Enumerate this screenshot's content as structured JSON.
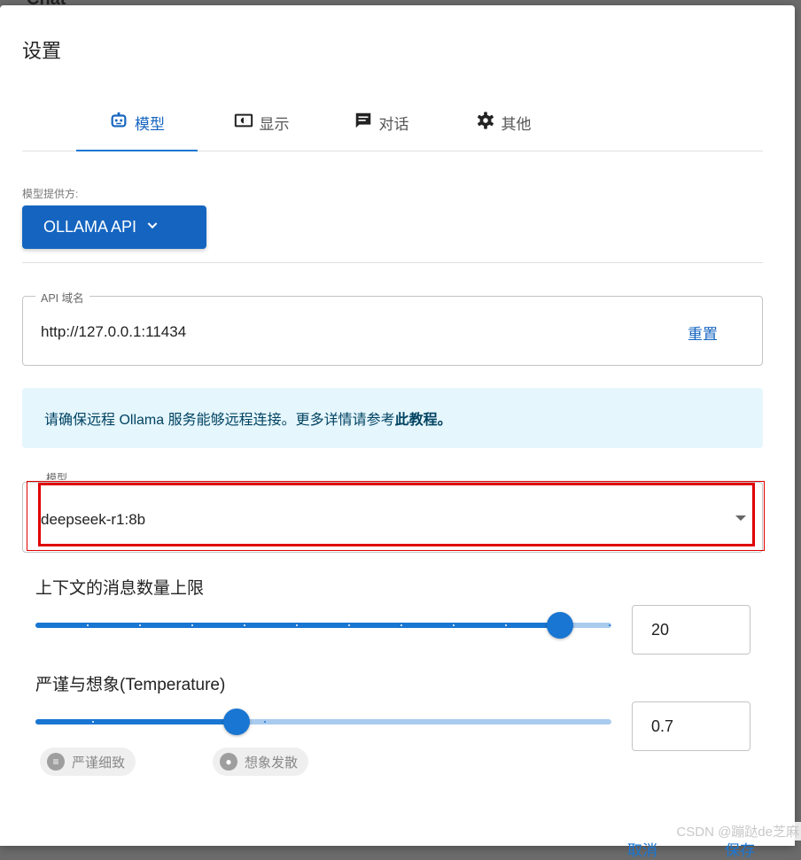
{
  "background": {
    "title": "Chat"
  },
  "dialog": {
    "title": "设置",
    "tabs": [
      {
        "label": "模型",
        "icon": "robot-icon",
        "active": true
      },
      {
        "label": "显示",
        "icon": "display-icon",
        "active": false
      },
      {
        "label": "对话",
        "icon": "chat-icon",
        "active": false
      },
      {
        "label": "其他",
        "icon": "gear-icon",
        "active": false
      }
    ],
    "provider": {
      "label": "模型提供方:",
      "value": "OLLAMA API"
    },
    "api": {
      "legend": "API 域名",
      "value": "http://127.0.0.1:11434",
      "reset": "重置"
    },
    "info": {
      "text": "请确保远程 Ollama 服务能够远程连接。更多详情请参考",
      "link": "此教程。"
    },
    "model": {
      "legend": "模型",
      "value": "deepseek-r1:8b"
    },
    "context_limit": {
      "label": "上下文的消息数量上限",
      "value": "20",
      "fraction": 0.91
    },
    "temperature": {
      "label": "严谨与想象(Temperature)",
      "value": "0.7",
      "fraction": 0.35,
      "chip_strict": "严谨细致",
      "chip_imaginative": "想象发散"
    },
    "buttons": {
      "cancel": "取消",
      "save": "保存"
    }
  },
  "colors": {
    "accent": "#1976d2",
    "primary_button": "#1565c0",
    "info_bg": "#e5f6fd",
    "highlight": "#e00000"
  },
  "watermark": "CSDN @蹦跶de芝麻"
}
